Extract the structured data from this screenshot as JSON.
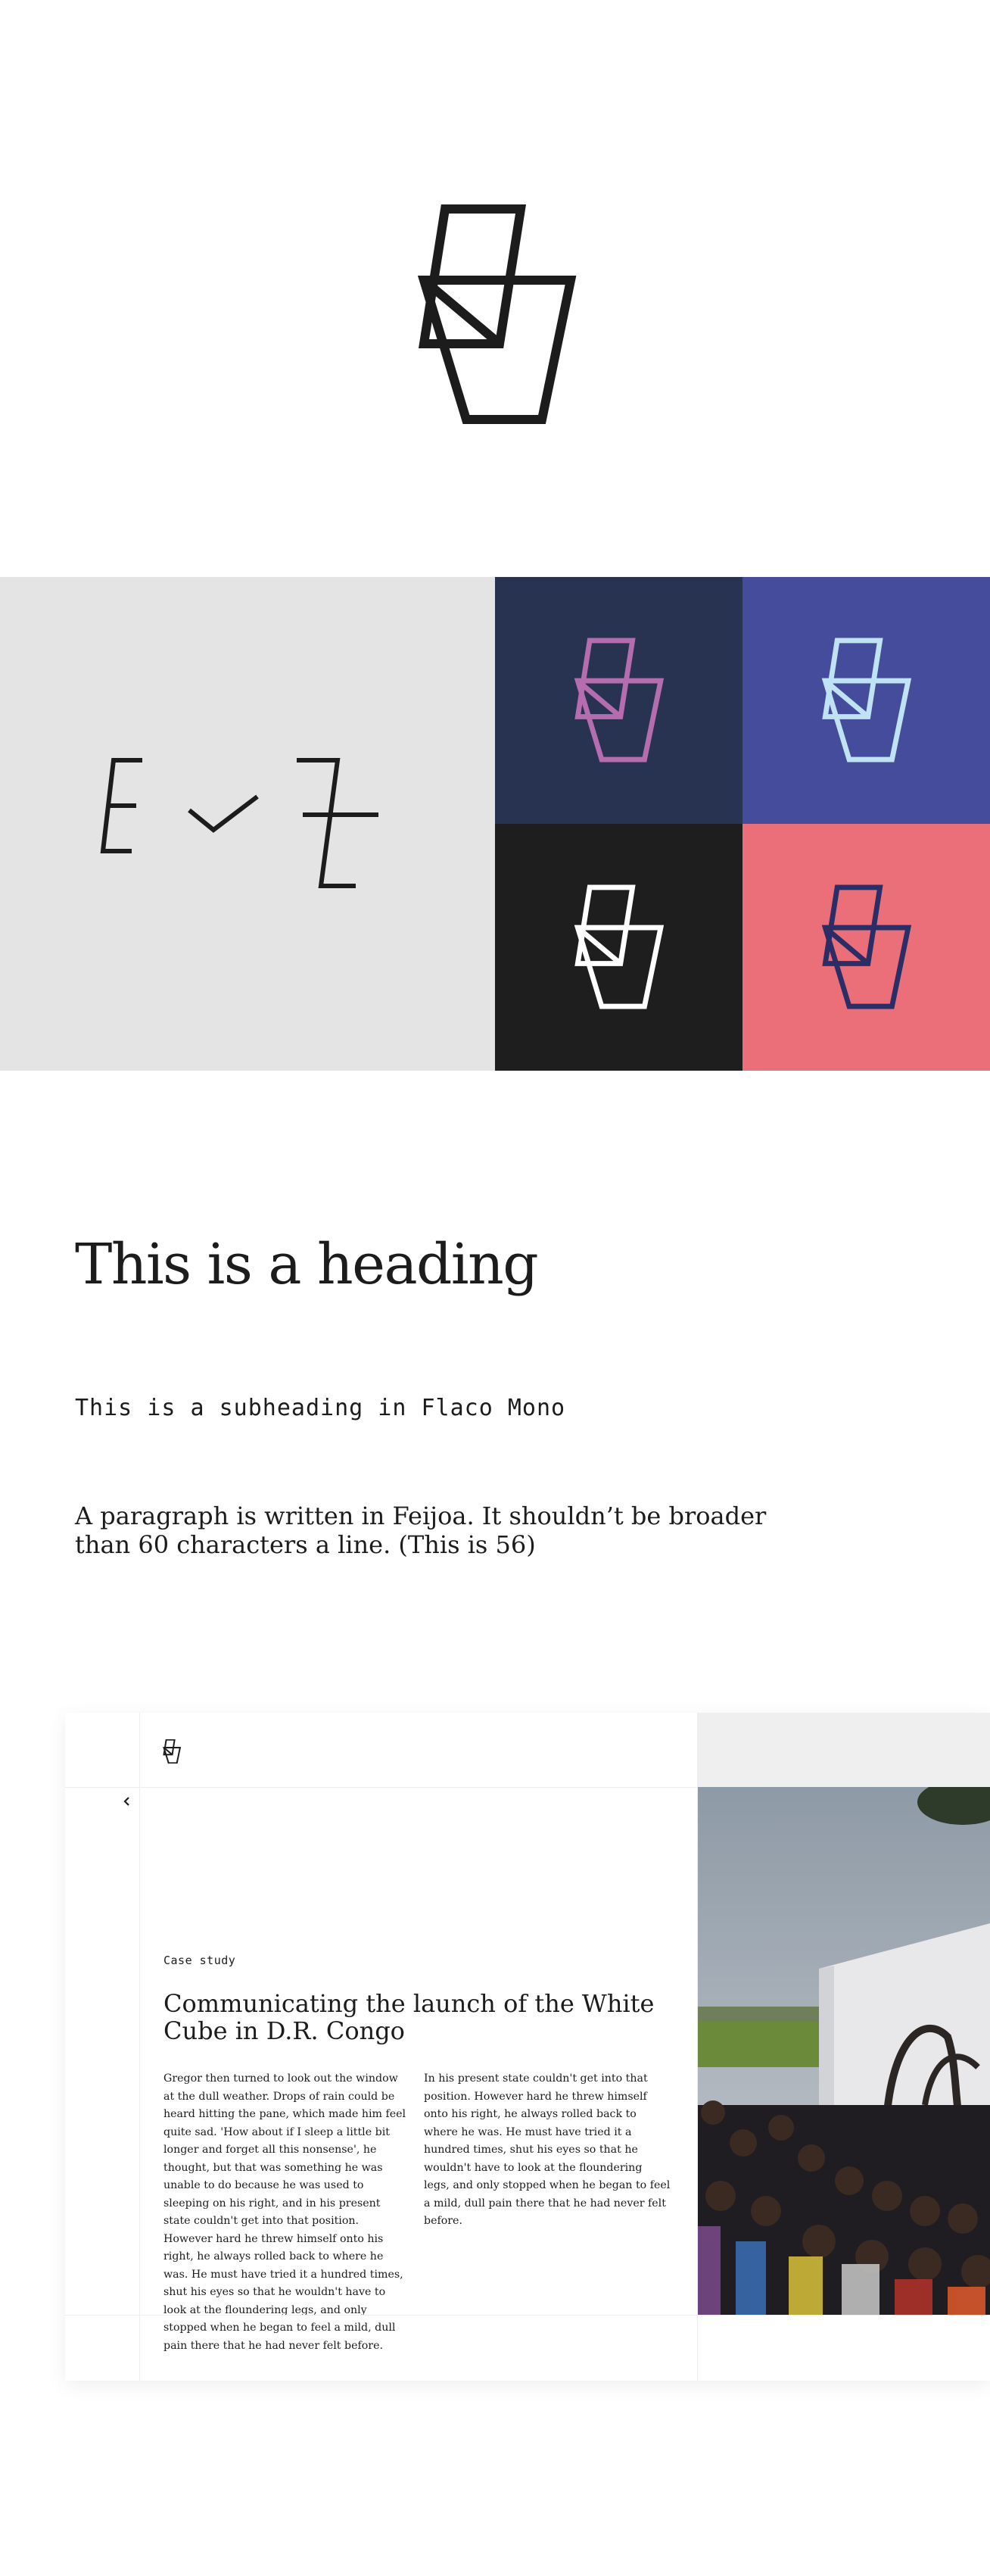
{
  "colors": {
    "ink": "#1c1c1c",
    "panel_grey": "#e4e4e4",
    "navy": "#283352",
    "indigo": "#464c9c",
    "black": "#1e1e1e",
    "coral": "#eb6f79",
    "lilac": "#b56db0",
    "ice": "#bfe3f3",
    "white": "#ffffff",
    "dark_navy": "#2a2d66"
  },
  "brand": {
    "logo_icon": "folded-shapes-logo-icon",
    "wordmark_icon": "wordmark-logo-icon"
  },
  "typography": {
    "heading": "This is a heading",
    "subheading": "This is a subheading in Flaco Mono",
    "paragraph": "A paragraph is written in Feijoa. It shouldn’t be broader than 60 characters a line. (This is 56)"
  },
  "case_study": {
    "back_icon": "chevron-left-icon",
    "label": "Case study",
    "title": "Communicating the launch of the White Cube in D.R. Congo",
    "column_1": "Gregor then turned to look out the window at the dull weather. Drops of rain could be heard hitting the pane, which made him feel quite sad. 'How about if I sleep a little bit longer and forget all this nonsense', he thought, but that was something he was unable to do because he was used to sleeping on his right, and in his present state couldn't get into that position. However hard he threw himself onto his right, he always rolled back to where he was. He must have tried it a hundred times, shut his eyes so that he wouldn't have to look at the floundering legs, and only stopped when he began to feel a mild, dull pain there that he had never felt before.",
    "column_2": "In his present state couldn't get into that position. However hard he threw himself onto his right, he always rolled back to where he was. He must have tried it a hundred times, shut his eyes so that he wouldn't have to look at the floundering legs, and only stopped when he began to feel a mild, dull pain there that he had never felt before."
  }
}
